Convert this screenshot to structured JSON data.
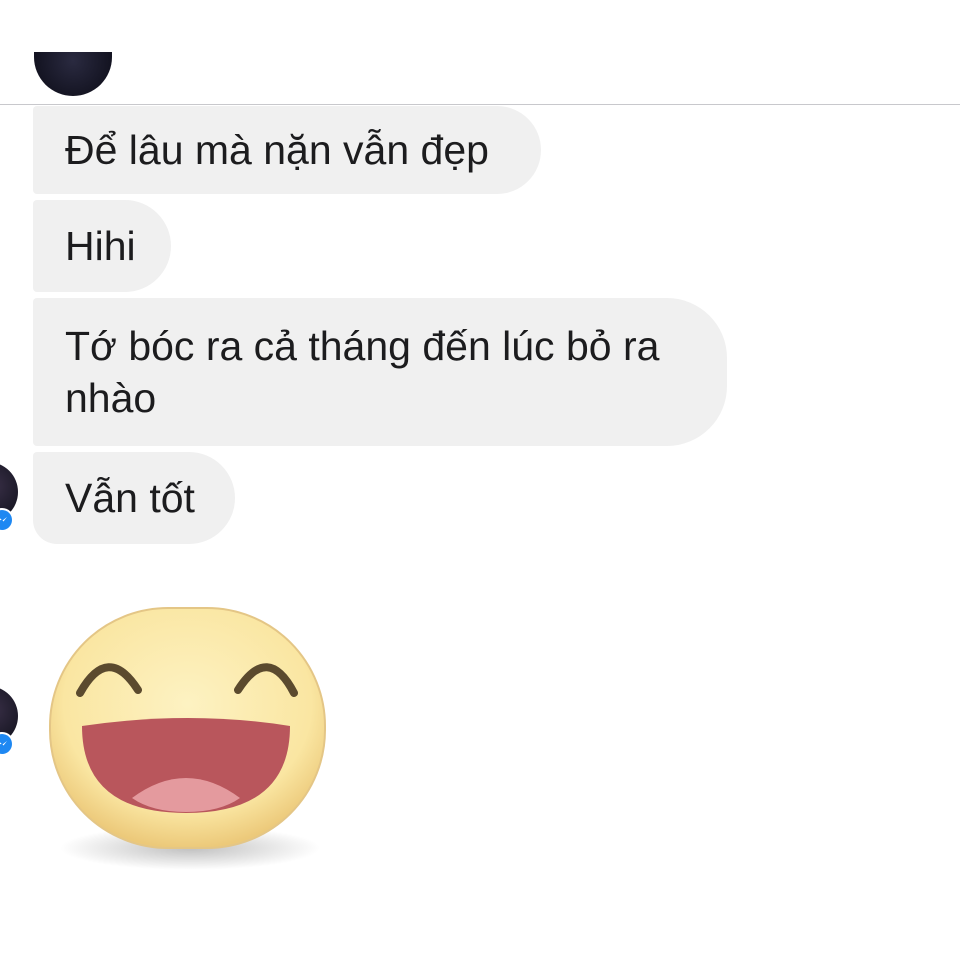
{
  "messages": [
    {
      "text": "Để lâu mà nặn vẫn đẹp"
    },
    {
      "text": "Hihi"
    },
    {
      "text": "Tớ bóc ra cả tháng đến lúc bỏ ra\nnhào"
    },
    {
      "text": "Vẫn tốt"
    }
  ],
  "sticker": {
    "icon": "laughing-face-sticker"
  },
  "colors": {
    "bubble_bg": "#f0f0f0",
    "text": "#1c1c1e",
    "messenger_blue": "#1e88f2",
    "sticker_face": "#fbe8a6",
    "sticker_mouth": "#b8525a"
  }
}
